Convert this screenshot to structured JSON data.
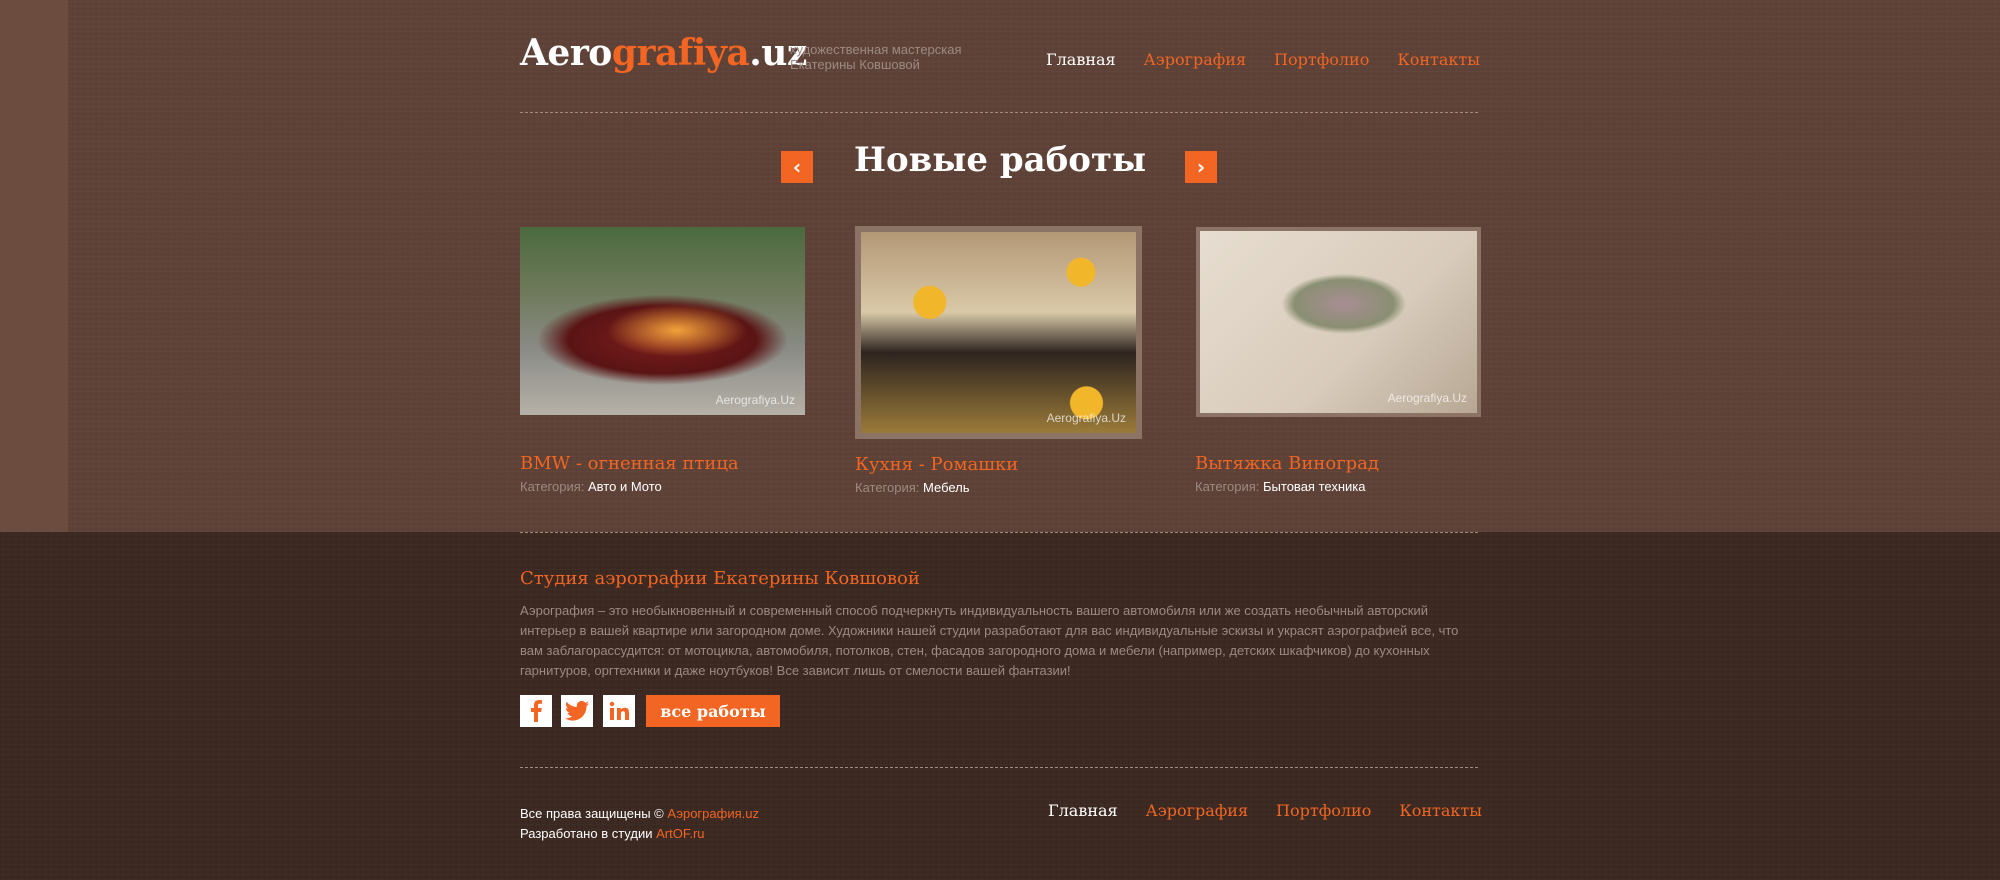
{
  "header": {
    "logo_part1": "Aero",
    "logo_part2": "grafiya",
    "logo_part3": ".uz",
    "tagline_line1": "художественная мастерская",
    "tagline_line2": "Екатерины Ковшовой",
    "nav": [
      "Главная",
      "Аэрография",
      "Портфолио",
      "Контакты"
    ]
  },
  "slider": {
    "title": "Новые работы",
    "prev_icon": "chevron-left-icon",
    "next_icon": "chevron-right-icon"
  },
  "works": [
    {
      "title": "BMW - огненная птица",
      "category_label": "Категория:",
      "category": "Авто и Мото",
      "watermark": "Aerografiya.Uz"
    },
    {
      "title": "Кухня - Ромашки",
      "category_label": "Категория:",
      "category": "Мебель",
      "watermark": "Aerografiya.Uz"
    },
    {
      "title": "Вытяжка Виноград",
      "category_label": "Категория:",
      "category": "Бытовая техника",
      "watermark": "Aerografiya.Uz"
    }
  ],
  "studio": {
    "title": "Студия аэрографии Екатерины Ковшовой",
    "text": "Аэрография – это необыкновенный и современный способ подчеркнуть индивидуальность вашего автомобиля или же создать необычный авторский интерьер в вашей квартире или загородном доме. Художники нашей студии  разработают для вас индивидуальные эскизы и украсят аэрографией все, что вам заблагорассудится: от мотоцикла, автомобиля, потолков, стен, фасадов загородного дома и мебели (например, детских шкафчиков) до кухонных гарнитуров, оргтехники и даже ноутбуков! Все зависит лишь от смелости вашей фантазии!",
    "social": [
      "facebook-icon",
      "twitter-icon",
      "linkedin-icon"
    ],
    "all_works_label": "все работы"
  },
  "footer": {
    "rights_text": "Все права защищены © ",
    "rights_link": "Аэрография.uz",
    "dev_text": "Разработано в студии ",
    "dev_link": "ArtOF.ru",
    "nav": [
      "Главная",
      "Аэрография",
      "Портфолио",
      "Контакты"
    ]
  },
  "colors": {
    "accent": "#f26522",
    "top_bg": "#5e4237",
    "bottom_bg": "#3b2922",
    "muted_text": "#9c8a82"
  }
}
